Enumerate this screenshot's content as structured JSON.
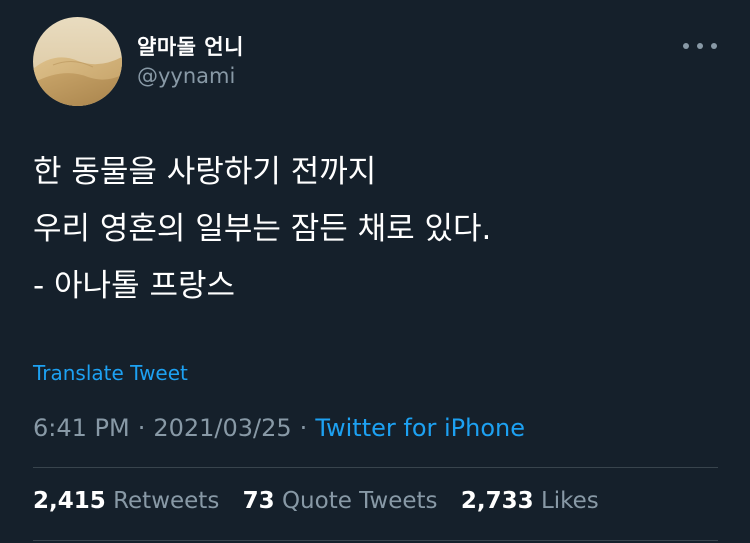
{
  "user": {
    "display_name": "얄마돌 언니",
    "handle": "@yynami",
    "avatar_icon": "desert-dune-avatar"
  },
  "more_icon": "more-horizontal-icon",
  "tweet": {
    "lines": [
      "한 동물을 사랑하기 전까지",
      "우리 영혼의 일부는 잠든 채로 있다.",
      "- 아나톨 프랑스"
    ],
    "translate_label": "Translate Tweet",
    "time": "6:41 PM",
    "date": "2021/03/25",
    "separator": "·",
    "source": "Twitter for iPhone"
  },
  "stats": {
    "retweets_count": "2,415",
    "retweets_label": "Retweets",
    "quote_count": "73",
    "quote_label": "Quote Tweets",
    "likes_count": "2,733",
    "likes_label": "Likes"
  },
  "colors": {
    "background": "#15202b",
    "text": "#ffffff",
    "secondary": "#8899a6",
    "accent": "#1da1f2",
    "divider": "#38444d"
  }
}
